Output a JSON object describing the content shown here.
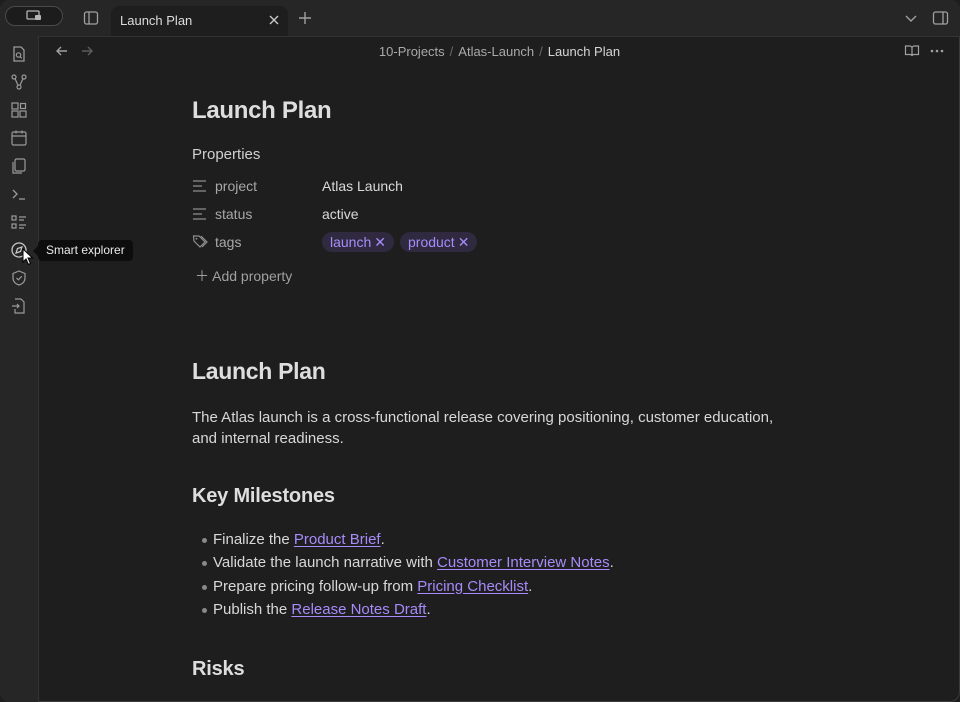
{
  "tab": {
    "title": "Launch Plan"
  },
  "breadcrumb": {
    "items": [
      "10-Projects",
      "Atlas-Launch"
    ],
    "current": "Launch Plan",
    "separator": "/"
  },
  "tooltip": {
    "text": "Smart explorer"
  },
  "note": {
    "title": "Launch Plan",
    "properties_heading": "Properties",
    "properties": [
      {
        "key": "project",
        "value": "Atlas Launch",
        "icon": "text-lines-icon"
      },
      {
        "key": "status",
        "value": "active",
        "icon": "text-lines-icon"
      },
      {
        "key": "tags",
        "icon": "tags-icon",
        "tags": [
          "launch",
          "product"
        ]
      }
    ],
    "add_property": "Add property",
    "h1": "Launch Plan",
    "intro": "The Atlas launch is a cross-functional release covering positioning, customer education, and internal readiness.",
    "milestones_heading": "Key Milestones",
    "milestones": [
      {
        "pre": "Finalize the ",
        "link": "Product Brief",
        "post": "."
      },
      {
        "pre": "Validate the launch narrative with ",
        "link": "Customer Interview Notes",
        "post": "."
      },
      {
        "pre": "Prepare pricing follow-up from ",
        "link": "Pricing Checklist",
        "post": "."
      },
      {
        "pre": "Publish the ",
        "link": "Release Notes Draft",
        "post": "."
      }
    ],
    "risks_heading": "Risks"
  },
  "colors": {
    "accent": "#a78bfa",
    "tag_bg": "#2f2a3f",
    "background": "#1e1e1e",
    "chrome": "#262626"
  }
}
